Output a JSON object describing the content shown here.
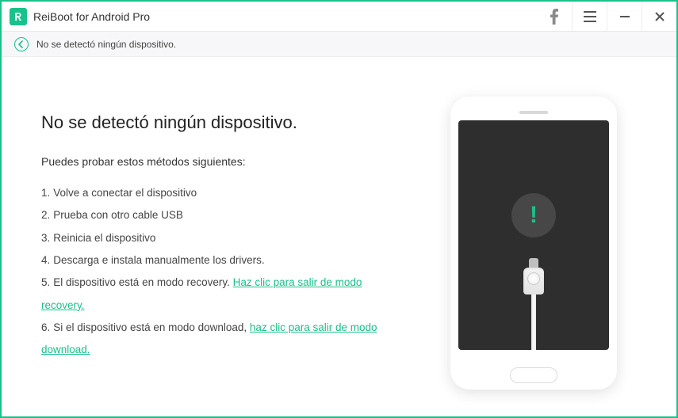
{
  "app": {
    "title": "ReiBoot for Android Pro"
  },
  "status": {
    "message": "No se detectó ningún dispositivo."
  },
  "main": {
    "heading": "No se detectó ningún dispositivo.",
    "subheading": "Puedes probar estos métodos siguientes:",
    "steps": [
      {
        "n": "1.",
        "text": "Volve a conectar el dispositivo"
      },
      {
        "n": "2.",
        "text": "Prueba con otro cable USB"
      },
      {
        "n": "3.",
        "text": "Reinicia el dispositivo"
      },
      {
        "n": "4.",
        "text": "Descarga e instala manualmente los drivers."
      },
      {
        "n": "5.",
        "text_before": "El dispositivo está en modo recovery. ",
        "link": "Haz clic para salir de modo recovery."
      },
      {
        "n": "6.",
        "text_before": "Si el dispositivo está en modo download, ",
        "link": "haz clic para salir de modo download."
      }
    ]
  },
  "illustration": {
    "alert_mark": "!"
  }
}
